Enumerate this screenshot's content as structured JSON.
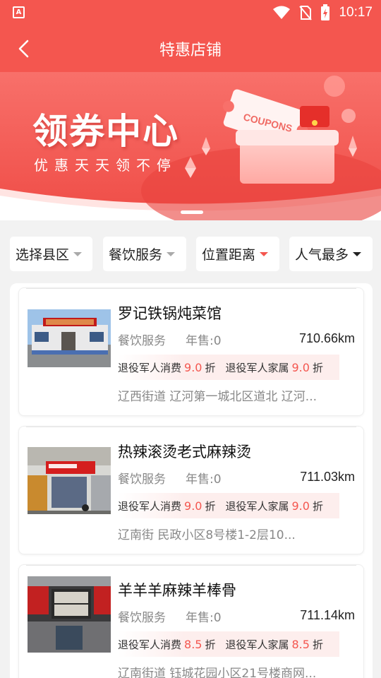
{
  "status_bar": {
    "time": "10:17",
    "app_badge": "A"
  },
  "header": {
    "title": "特惠店铺"
  },
  "banner": {
    "title": "领券中心",
    "subtitle": "优惠天天领不停",
    "coupon_text": "COUPONS"
  },
  "filters": [
    {
      "label": "选择县区"
    },
    {
      "label": "餐饮服务"
    },
    {
      "label": "位置距离"
    },
    {
      "label": "人气最多"
    }
  ],
  "colors": {
    "accent": "#f4564f",
    "discount": "#f4564f",
    "discount_bg": "#fdeeed"
  },
  "shops": [
    {
      "name": "罗记铁锅炖菜馆",
      "category": "餐饮服务",
      "sales": "年售:0",
      "distance": "710.66km",
      "discount_veteran_label": "退役军人消费",
      "discount_veteran_rate": "9.0",
      "discount_unit": "折",
      "discount_family_label": "退役军人家属",
      "discount_family_rate": "9.0",
      "address": "辽西街道 辽河第一城北区道北 辽河..."
    },
    {
      "name": "热辣滚烫老式麻辣烫",
      "category": "餐饮服务",
      "sales": "年售:0",
      "distance": "711.03km",
      "discount_veteran_label": "退役军人消费",
      "discount_veteran_rate": "9.0",
      "discount_unit": "折",
      "discount_family_label": "退役军人家属",
      "discount_family_rate": "9.0",
      "address": "辽南街 民政小区8号楼1-2层10..."
    },
    {
      "name": "羊羊羊麻辣羊棒骨",
      "category": "餐饮服务",
      "sales": "年售:0",
      "distance": "711.14km",
      "discount_veteran_label": "退役军人消费",
      "discount_veteran_rate": "8.5",
      "discount_unit": "折",
      "discount_family_label": "退役军人家属",
      "discount_family_rate": "8.5",
      "address": "辽南街道 钰城花园小区21号楼商网..."
    }
  ]
}
